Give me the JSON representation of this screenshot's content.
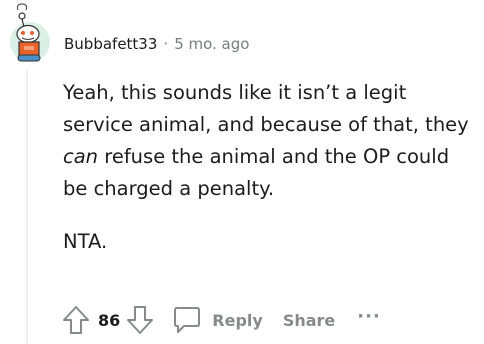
{
  "comment": {
    "username": "Bubbafett33",
    "separator": "·",
    "timestamp": "5 mo. ago",
    "body": {
      "line1_prefix": "Yeah, this sounds like it isn’t a legit service animal, and because of that, they ",
      "emphasis": "can",
      "line1_suffix": " refuse the animal and the OP could be charged a penalty.",
      "paragraph2": "NTA."
    },
    "actions": {
      "vote_count": "86",
      "reply_label": "Reply",
      "share_label": "Share",
      "more_label": "···"
    },
    "icons": {
      "avatar": "snoo-avatar-icon",
      "upvote": "upvote-arrow-icon",
      "downvote": "downvote-arrow-icon",
      "comment": "comment-bubble-icon"
    },
    "colors": {
      "text": "#1c1c1c",
      "meta": "#787c7e",
      "action": "#878a8c",
      "avatar_bg": "#dcefe6",
      "shirt": "#e8632c"
    }
  }
}
